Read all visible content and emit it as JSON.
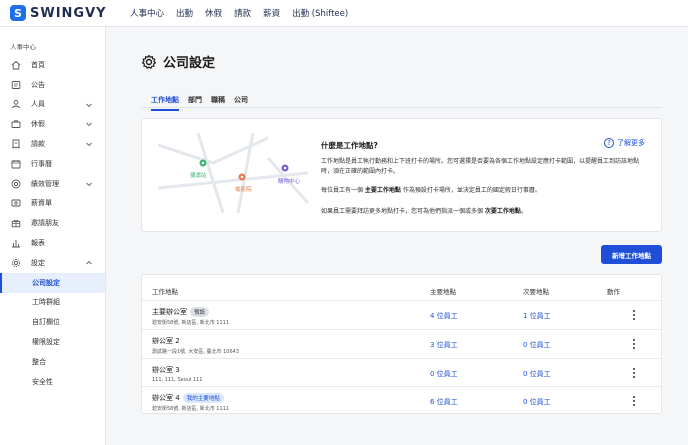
{
  "app": {
    "logo_letter": "S",
    "logo_text": "SWINGVY"
  },
  "topnav": [
    "人事中心",
    "出勤",
    "休假",
    "請款",
    "薪資",
    "出勤 (Shiftee)"
  ],
  "sidebar": {
    "section": "人事中心",
    "items": [
      {
        "label": "首頁",
        "icon": "home-icon"
      },
      {
        "label": "公告",
        "icon": "announcement-icon"
      },
      {
        "label": "人員",
        "icon": "person-icon",
        "expandable": true
      },
      {
        "label": "休假",
        "icon": "briefcase-icon",
        "expandable": true
      },
      {
        "label": "請款",
        "icon": "receipt-icon",
        "expandable": true
      },
      {
        "label": "行事曆",
        "icon": "calendar-icon"
      },
      {
        "label": "績效管理",
        "icon": "target-icon",
        "expandable": true
      },
      {
        "label": "薪資單",
        "icon": "payslip-icon"
      },
      {
        "label": "邀請朋友",
        "icon": "gift-icon"
      },
      {
        "label": "報表",
        "icon": "chart-icon"
      },
      {
        "label": "設定",
        "icon": "gear-icon",
        "expandable": true,
        "expanded": true
      }
    ],
    "subitems": [
      {
        "label": "公司設定",
        "active": true
      },
      {
        "label": "工時群組"
      },
      {
        "label": "自訂欄位"
      },
      {
        "label": "權限設定"
      },
      {
        "label": "整合"
      },
      {
        "label": "安全性"
      }
    ]
  },
  "page": {
    "title": "公司設定"
  },
  "tabs": [
    {
      "label": "工作地點",
      "active": true
    },
    {
      "label": "部門"
    },
    {
      "label": "職稱"
    },
    {
      "label": "公司"
    }
  ],
  "info": {
    "title": "什麼是工作地點?",
    "learn_more": "了解更多",
    "map_labels": [
      "捷運站",
      "電影院",
      "購物中心"
    ],
    "p1": "工作地點是員工執行勤務和上下班打卡的場所。您可選擇是否要為各個工作地點設定應打卡範圍，以提醒員工到訪該地點時，須在正確的範圍內打卡。",
    "p2_a": "每位員工有一個 ",
    "p2_b": "主要工作地點",
    "p2_c": " 作為預設打卡場所，並決定員工的國定假日行事曆。",
    "p3_a": "如果員工需要拜訪更多地點打卡，您可為他們指派一個或多個 ",
    "p3_b": "次要工作地點",
    "p3_c": "。"
  },
  "add_button": "新增工作地點",
  "table": {
    "headers": [
      "工作地點",
      "主要地點",
      "次要地點",
      "動作"
    ],
    "rows": [
      {
        "name": "主要辦公室",
        "badge": "預設",
        "badge_style": "grey",
        "address": "碧安街58號, 新店區, 新北市 1111",
        "primary": "4 位員工",
        "secondary": "1 位員工"
      },
      {
        "name": "辦公室 2",
        "badge": "",
        "badge_style": "",
        "address": "測試路一段1號, 大安區, 臺北市 10643",
        "primary": "3 位員工",
        "secondary": "0 位員工"
      },
      {
        "name": "辦公室 3",
        "badge": "",
        "badge_style": "",
        "address": "111, 111, Seoul 111",
        "primary": "0 位員工",
        "secondary": "0 位員工"
      },
      {
        "name": "辦公室 4",
        "badge": "我的主要地點",
        "badge_style": "blue",
        "address": "碧安街58號, 新店區, 新北市 1111",
        "primary": "6 位員工",
        "secondary": "0 位員工"
      }
    ]
  },
  "colors": {
    "accent": "#1f4fd6",
    "map_green": "#3cb371",
    "map_orange": "#e8794a",
    "map_purple": "#7b5cd6"
  }
}
